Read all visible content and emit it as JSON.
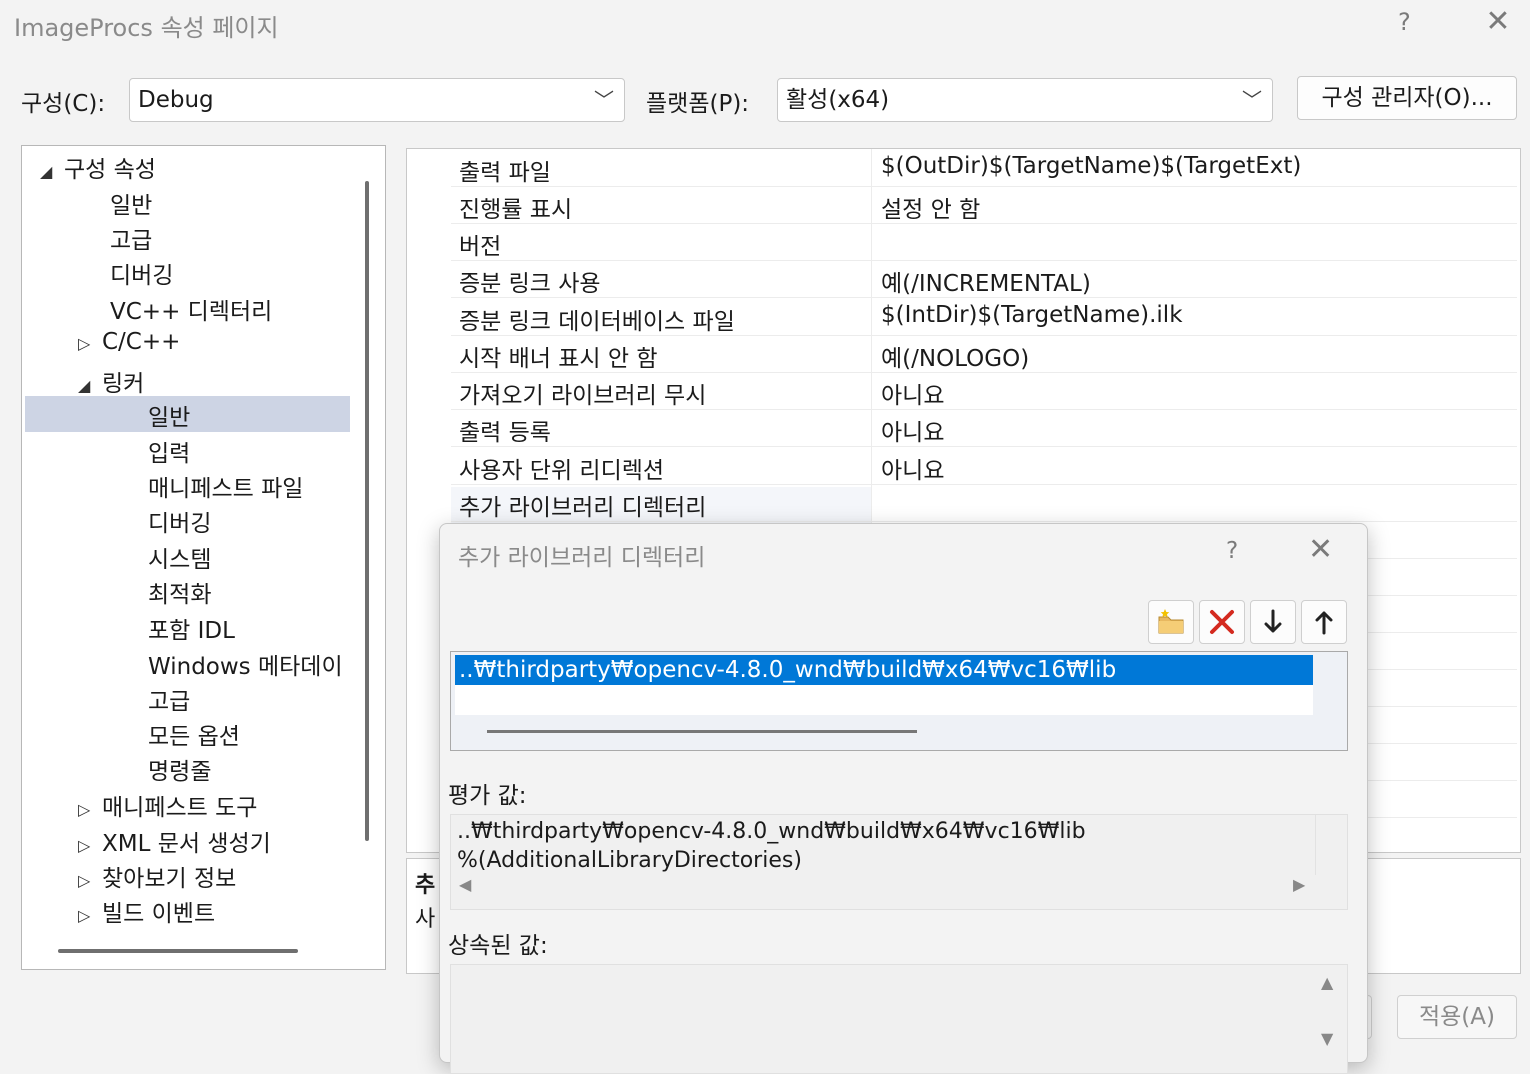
{
  "window": {
    "title": "ImageProcs 속성 페이지",
    "help": "?",
    "close": "✕"
  },
  "config": {
    "config_label": "구성(C):",
    "config_value": "Debug",
    "platform_label": "플랫폼(P):",
    "platform_value": "활성(x64)",
    "manager_button": "구성 관리자(O)..."
  },
  "tree": {
    "items": [
      {
        "label": "구성 속성",
        "arrow": "◢"
      },
      {
        "label": "일반",
        "arrow": ""
      },
      {
        "label": "고급",
        "arrow": ""
      },
      {
        "label": "디버깅",
        "arrow": ""
      },
      {
        "label": "VC++ 디렉터리",
        "arrow": ""
      },
      {
        "label": "C/C++",
        "arrow": "▷"
      },
      {
        "label": "링커",
        "arrow": "◢"
      },
      {
        "label": "일반",
        "arrow": ""
      },
      {
        "label": "입력",
        "arrow": ""
      },
      {
        "label": "매니페스트 파일",
        "arrow": ""
      },
      {
        "label": "디버깅",
        "arrow": ""
      },
      {
        "label": "시스템",
        "arrow": ""
      },
      {
        "label": "최적화",
        "arrow": ""
      },
      {
        "label": "포함 IDL",
        "arrow": ""
      },
      {
        "label": "Windows 메타데이",
        "arrow": ""
      },
      {
        "label": "고급",
        "arrow": ""
      },
      {
        "label": "모든 옵션",
        "arrow": ""
      },
      {
        "label": "명령줄",
        "arrow": ""
      },
      {
        "label": "매니페스트 도구",
        "arrow": "▷"
      },
      {
        "label": "XML 문서 생성기",
        "arrow": "▷"
      },
      {
        "label": "찾아보기 정보",
        "arrow": "▷"
      },
      {
        "label": "빌드 이벤트",
        "arrow": "▷"
      }
    ]
  },
  "grid": {
    "rows": [
      {
        "name": "출력 파일",
        "value": "$(OutDir)$(TargetName)$(TargetExt)"
      },
      {
        "name": "진행률 표시",
        "value": "설정 안 함"
      },
      {
        "name": "버전",
        "value": ""
      },
      {
        "name": "증분 링크 사용",
        "value": "예(/INCREMENTAL)"
      },
      {
        "name": "증분 링크 데이터베이스 파일",
        "value": "$(IntDir)$(TargetName).ilk"
      },
      {
        "name": "시작 배너 표시 안 함",
        "value": "예(/NOLOGO)"
      },
      {
        "name": "가져오기 라이브러리 무시",
        "value": "아니요"
      },
      {
        "name": "출력 등록",
        "value": "아니요"
      },
      {
        "name": "사용자 단위 리디렉션",
        "value": "아니요"
      },
      {
        "name": "추가 라이브러리 디렉터리",
        "value": ""
      }
    ]
  },
  "description": {
    "title": "추",
    "body": "사"
  },
  "apply_button": "적용(A)",
  "dialog": {
    "title": "추가 라이브러리 디렉터리",
    "help": "?",
    "close": "✕",
    "toolbar": {
      "new_folder": "new-folder-icon",
      "delete": "delete-icon",
      "move_down": "arrow-down-icon",
      "move_up": "arrow-up-icon"
    },
    "selected_dir": "..₩thirdparty₩opencv-4.8.0_wnd₩build₩x64₩vc16₩lib",
    "eval_label": "평가 값:",
    "eval_lines": [
      "..₩thirdparty₩opencv-4.8.0_wnd₩build₩x64₩vc16₩lib",
      "%(AdditionalLibraryDirectories)"
    ],
    "inherited_label": "상속된 값:"
  }
}
